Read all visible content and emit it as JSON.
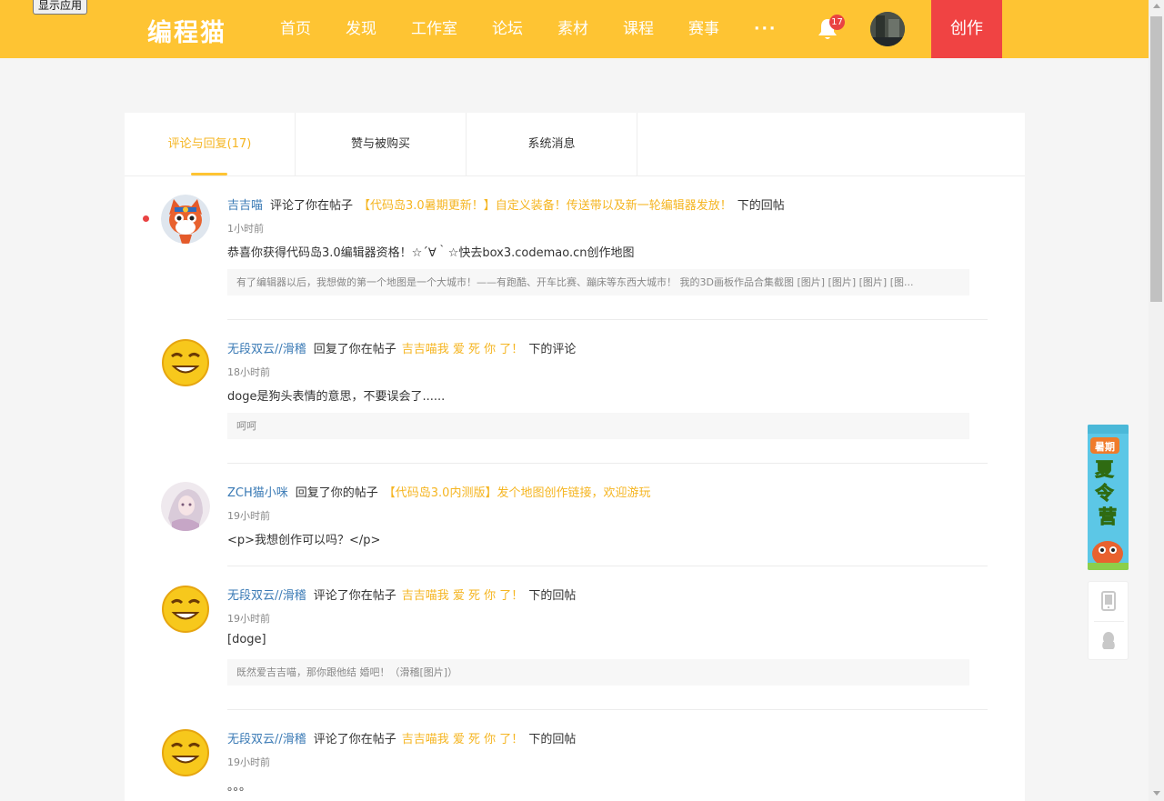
{
  "top_button": "显示应用",
  "header": {
    "logo": "编程猫",
    "nav": [
      "首页",
      "发现",
      "工作室",
      "论坛",
      "素材",
      "课程",
      "赛事"
    ],
    "more": "···",
    "notification_count": "17",
    "create_label": "创作",
    "colors": {
      "bar": "#fec433",
      "create": "#f04343"
    }
  },
  "tabs": [
    {
      "label": "评论与回复(17)",
      "active": true
    },
    {
      "label": "赞与被购买",
      "active": false
    },
    {
      "label": "系统消息",
      "active": false
    }
  ],
  "messages": [
    {
      "user": "吉吉喵",
      "action": "评论了你在帖子",
      "post": "【代码岛3.0暑期更新！】自定义装备！传送带以及新一轮编辑器发放！",
      "suffix": "下的回帖",
      "time": "1小时前",
      "content": "恭喜你获得代码岛3.0编辑器资格！☆´∀｀☆快去box3.codemao.cn创作地图",
      "quote": "有了编辑器以后，我想做的第一个地图是一个大城市！——有跑酷、开车比赛、蹦床等东西大城市！ 我的3D画板作品合集截图 [图片] [图片] [图片] [图...",
      "unread": true,
      "avatar": "cat-mascot"
    },
    {
      "user": "无段双云//滑稽",
      "action": "回复了你在帖子",
      "post": "吉吉喵我 爱 死 你 了！",
      "suffix": "下的评论",
      "time": "18小时前",
      "content": "doge是狗头表情的意思，不要误会了......",
      "quote": "呵呵",
      "unread": false,
      "avatar": "smiley"
    },
    {
      "user": "ZCH猫小咪",
      "action": "回复了你的帖子",
      "post": "【代码岛3.0内测版】发个地图创作链接，欢迎游玩",
      "suffix": "",
      "time": "19小时前",
      "content": "<p>我想创作可以吗？</p>",
      "quote": "",
      "unread": false,
      "avatar": "anime-girl"
    },
    {
      "user": "无段双云//滑稽",
      "action": "评论了你在帖子",
      "post": "吉吉喵我 爱 死 你 了！",
      "suffix": "下的回帖",
      "time": "19小时前",
      "content": "[doge]",
      "quote": "既然爱吉吉喵，那你跟他结 婚吧！（滑稽[图片]）",
      "unread": false,
      "avatar": "smiley"
    },
    {
      "user": "无段双云//滑稽",
      "action": "评论了你在帖子",
      "post": "吉吉喵我 爱 死 你 了！",
      "suffix": "下的回帖",
      "time": "19小时前",
      "content": "。。。",
      "quote": "",
      "unread": false,
      "avatar": "smiley"
    }
  ],
  "side": {
    "banner_small": "暑期",
    "banner_main": "夏令营",
    "tools": [
      "phone-icon",
      "qq-icon"
    ]
  }
}
